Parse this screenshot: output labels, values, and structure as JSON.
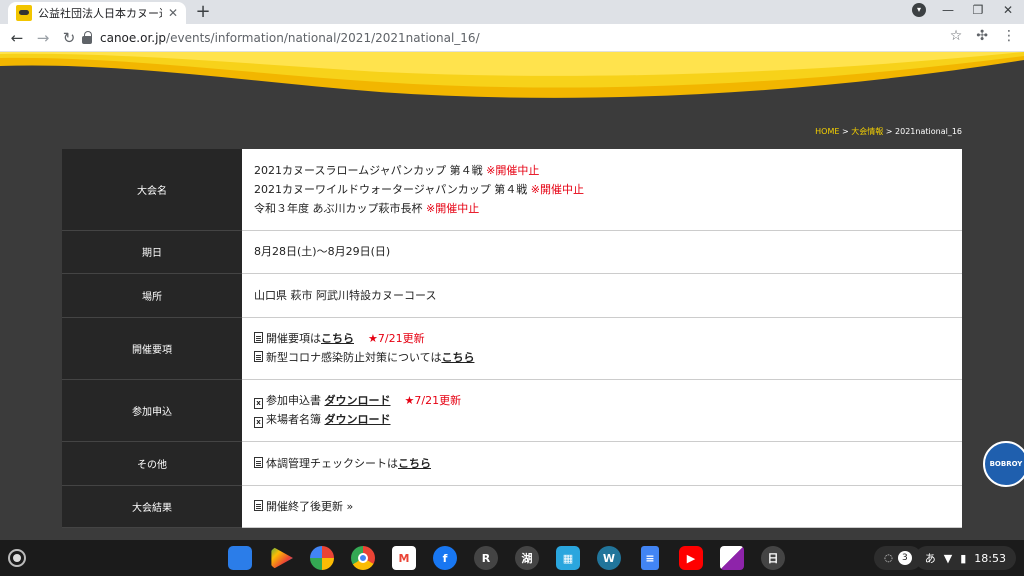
{
  "browser": {
    "tab_title": "公益社団法人日本カヌー連盟",
    "tab_close": "✕",
    "new_tab": "+",
    "url_domain": "canoe.or.jp",
    "url_path": "/events/information/national/2021/2021national_16/"
  },
  "breadcrumb": {
    "home": "HOME",
    "sep1": " > ",
    "section": "大会情報",
    "sep2": " > ",
    "current": "2021national_16"
  },
  "rows": {
    "name": {
      "label": "大会名",
      "line1": "2021カヌースラロームジャパンカップ 第４戦 ",
      "line1_status": "※開催中止",
      "line2": "2021カヌーワイルドウォータージャパンカップ 第４戦 ",
      "line2_status": "※開催中止",
      "line3": "令和３年度 あぶ川カップ萩市長杯 ",
      "line3_status": "※開催中止"
    },
    "date": {
      "label": "期日",
      "value": "8月28日(土)〜8月29日(日)"
    },
    "venue": {
      "label": "場所",
      "value": "山口県 萩市 阿武川特設カヌーコース"
    },
    "guidelines": {
      "label": "開催要項",
      "line1": "開催要項は",
      "line1_link": "こちら",
      "line1_note": "★7/21更新",
      "line2": "新型コロナ感染防止対策については",
      "line2_link": "こちら"
    },
    "entry": {
      "label": "参加申込",
      "line1": "参加申込書 ",
      "line1_link": "ダウンロード",
      "line1_note": "★7/21更新",
      "line2": "来場者名簿 ",
      "line2_link": "ダウンロード"
    },
    "other": {
      "label": "その他",
      "line1": "体調管理チェックシートは",
      "line1_link": "こちら"
    },
    "results": {
      "label": "大会結果",
      "value": "開催終了後更新 »"
    }
  },
  "badge": {
    "text": "BOBROY"
  },
  "shelf": {
    "apps": [
      "R",
      "湖",
      "日"
    ],
    "notification_count": "3",
    "ime": "あ",
    "time": "18:53"
  },
  "colors": {
    "accent_yellow": "#f5d000",
    "alert_red": "#e60012",
    "page_bg": "#3b3b3b"
  }
}
